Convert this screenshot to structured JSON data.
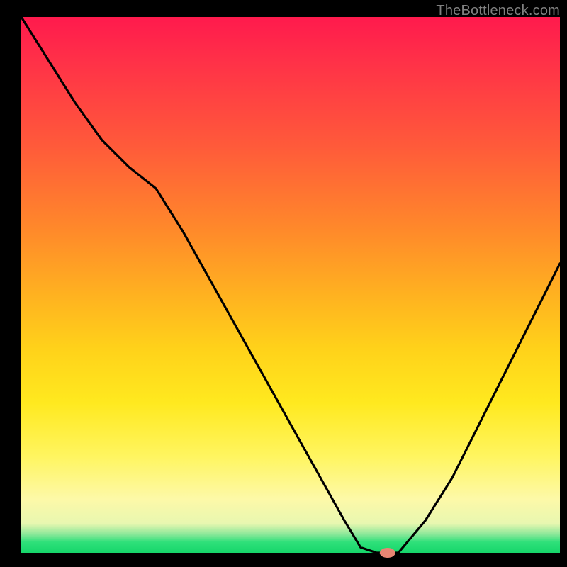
{
  "watermark": "TheBottleneck.com",
  "colors": {
    "background": "#000000",
    "curve": "#000000",
    "marker": "#e88573",
    "gradient_top": "#ff1a4d",
    "gradient_bottom": "#16d66b"
  },
  "chart_data": {
    "type": "line",
    "title": "",
    "xlabel": "",
    "ylabel": "",
    "xlim": [
      0,
      100
    ],
    "ylim": [
      0,
      100
    ],
    "x": [
      0,
      5,
      10,
      15,
      20,
      25,
      30,
      35,
      40,
      45,
      50,
      55,
      60,
      63,
      66,
      70,
      75,
      80,
      85,
      90,
      95,
      100
    ],
    "values": [
      100,
      92,
      84,
      77,
      72,
      68,
      60,
      51,
      42,
      33,
      24,
      15,
      6,
      1,
      0,
      0,
      6,
      14,
      24,
      34,
      44,
      54
    ],
    "note": "Bottleneck curve: y is bottleneck percentage vs an implicit x (component balance). Minimum (~0%) occurs around x≈63–70; a small marker sits at the bottom of the valley near x≈68.",
    "marker_point": {
      "x": 68,
      "y": 0
    }
  }
}
